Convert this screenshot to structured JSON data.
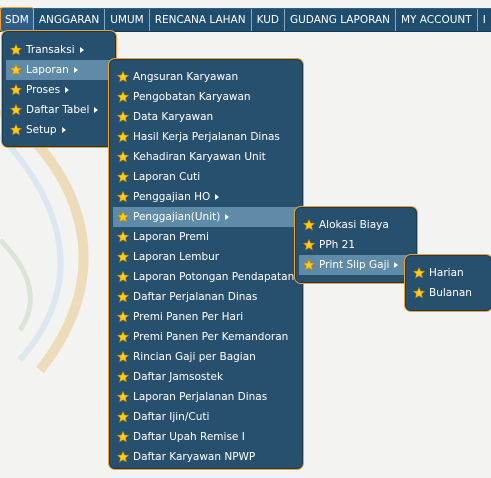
{
  "menubar": {
    "items": [
      "SDM",
      "ANGGARAN",
      "UMUM",
      "RENCANA LAHAN",
      "KUD",
      "GUDANG LAPORAN",
      "MY ACCOUNT",
      "I"
    ]
  },
  "sdm_menu": {
    "items": [
      {
        "label": "Transaksi",
        "submenu": true
      },
      {
        "label": "Laporan",
        "submenu": true
      },
      {
        "label": "Proses",
        "submenu": true
      },
      {
        "label": "Daftar Tabel",
        "submenu": true
      },
      {
        "label": "Setup",
        "submenu": true
      }
    ]
  },
  "laporan_menu": {
    "items": [
      {
        "label": "Angsuran Karyawan"
      },
      {
        "label": "Pengobatan Karyawan"
      },
      {
        "label": "Data Karyawan"
      },
      {
        "label": "Hasil Kerja Perjalanan Dinas"
      },
      {
        "label": "Kehadiran Karyawan Unit"
      },
      {
        "label": "Laporan Cuti"
      },
      {
        "label": "Penggajian HO",
        "submenu": true
      },
      {
        "label": "Penggajian(Unit)",
        "submenu": true
      },
      {
        "label": "Laporan Premi"
      },
      {
        "label": "Laporan Lembur"
      },
      {
        "label": "Laporan Potongan Pendapatan"
      },
      {
        "label": "Daftar Perjalanan Dinas"
      },
      {
        "label": "Premi Panen Per Hari"
      },
      {
        "label": "Premi Panen Per Kemandoran"
      },
      {
        "label": "Rincian Gaji per Bagian"
      },
      {
        "label": "Daftar Jamsostek"
      },
      {
        "label": "Laporan Perjalanan Dinas"
      },
      {
        "label": "Daftar Ijin/Cuti"
      },
      {
        "label": "Daftar Upah Remise I"
      },
      {
        "label": "Daftar Karyawan NPWP"
      }
    ]
  },
  "penggajian_unit_menu": {
    "items": [
      {
        "label": "Alokasi Biaya"
      },
      {
        "label": "PPh 21"
      },
      {
        "label": "Print Slip Gaji",
        "submenu": true
      }
    ]
  },
  "print_slip_menu": {
    "items": [
      {
        "label": "Harian"
      },
      {
        "label": "Bulanan"
      }
    ]
  },
  "colors": {
    "menu_bg": "#27506e",
    "menu_border": "#f0a030",
    "highlight": "#5f8aa8",
    "star": "#ffcc1a"
  }
}
